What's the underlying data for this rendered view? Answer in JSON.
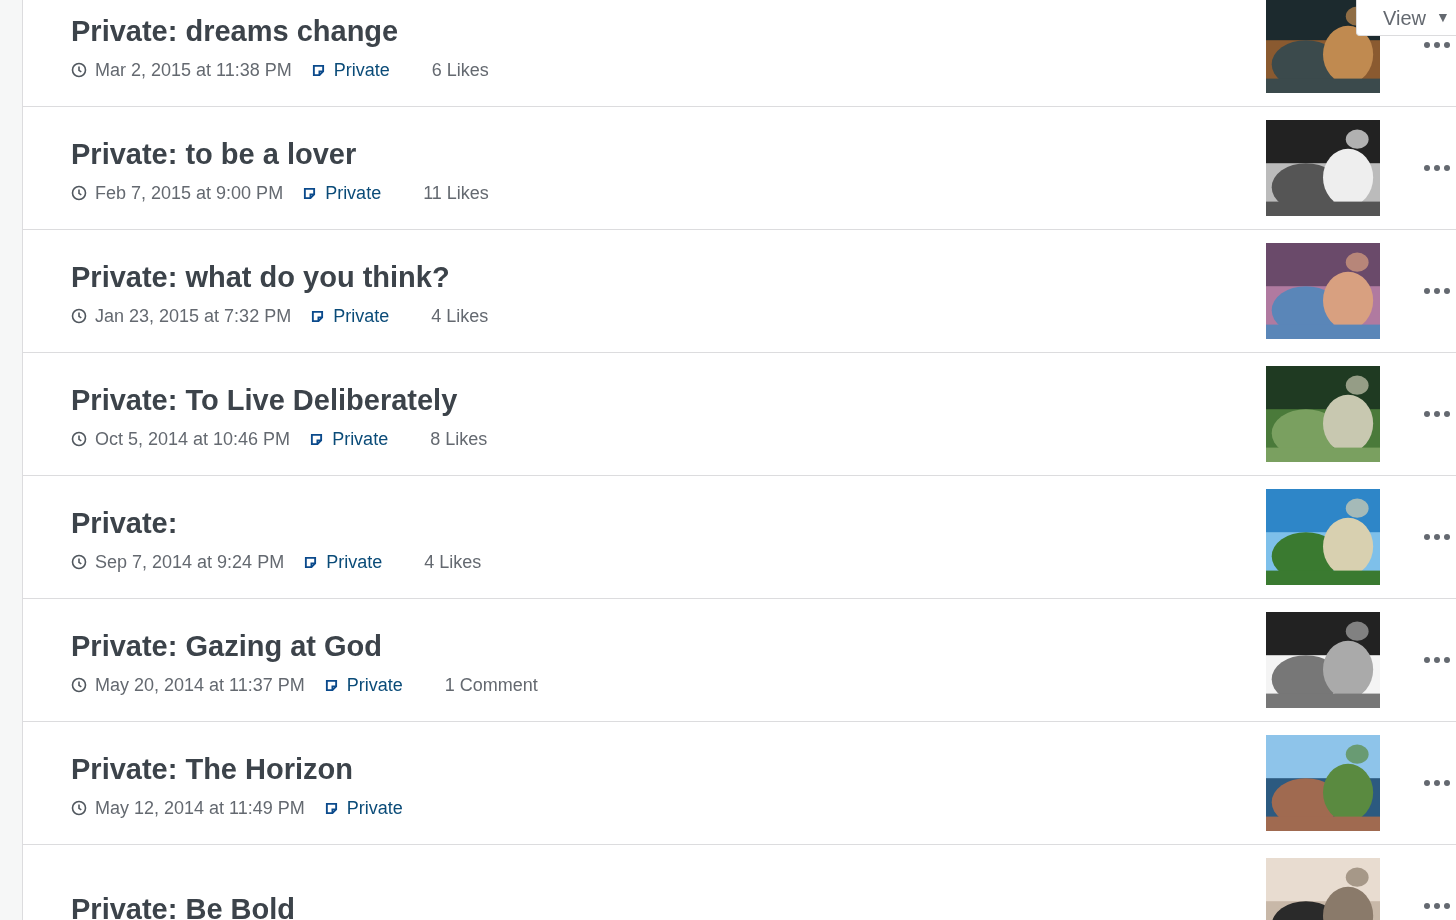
{
  "view_menu": {
    "label": "View",
    "caret": "▼"
  },
  "posts": [
    {
      "title": "Private: dreams change",
      "date": "Mar 2, 2015 at 11:38 PM",
      "status": "Private",
      "stats": "6 Likes"
    },
    {
      "title": "Private: to be a lover",
      "date": "Feb 7, 2015 at 9:00 PM",
      "status": "Private",
      "stats": "11 Likes"
    },
    {
      "title": "Private: what do you think?",
      "date": "Jan 23, 2015 at 7:32 PM",
      "status": "Private",
      "stats": "4 Likes"
    },
    {
      "title": "Private: To Live Deliberately",
      "date": "Oct 5, 2014 at 10:46 PM",
      "status": "Private",
      "stats": "8 Likes"
    },
    {
      "title": "Private:",
      "date": "Sep 7, 2014 at 9:24 PM",
      "status": "Private",
      "stats": "4 Likes"
    },
    {
      "title": "Private: Gazing at God",
      "date": "May 20, 2014 at 11:37 PM",
      "status": "Private",
      "stats": "1 Comment"
    },
    {
      "title": "Private: The Horizon",
      "date": "May 12, 2014 at 11:49 PM",
      "status": "Private"
    },
    {
      "title": "Private: Be Bold"
    }
  ]
}
